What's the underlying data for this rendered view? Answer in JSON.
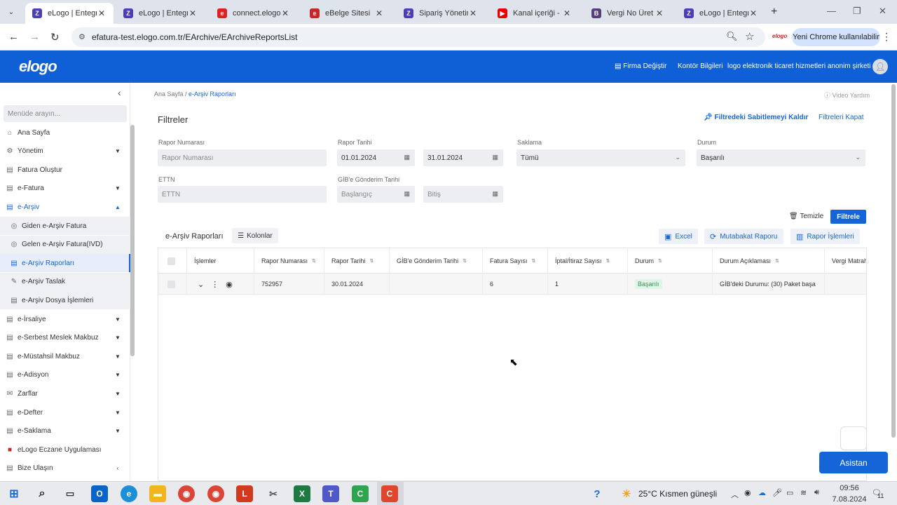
{
  "browser": {
    "tabs": [
      {
        "label": "eLogo | Entegrat",
        "active": true,
        "favicon_color": "#4b3fb3",
        "favicon_glyph": "Z"
      },
      {
        "label": "eLogo | Entegrat",
        "favicon_color": "#4b3fb3",
        "favicon_glyph": "Z"
      },
      {
        "label": "connect.elogo.cc",
        "favicon_color": "#d22",
        "favicon_glyph": "e"
      },
      {
        "label": "eBelge Sitesi",
        "favicon_color": "#c62828",
        "favicon_glyph": "e"
      },
      {
        "label": "Sipariş Yönetimi",
        "favicon_color": "#4b3fb3",
        "favicon_glyph": "Z"
      },
      {
        "label": "Kanal içeriği - Yo",
        "favicon_color": "#e00",
        "favicon_glyph": "▶"
      },
      {
        "label": "Vergi No Üret | V",
        "favicon_color": "#563d7c",
        "favicon_glyph": "B"
      },
      {
        "label": "eLogo | Entegrat",
        "favicon_color": "#4b3fb3",
        "favicon_glyph": "Z"
      }
    ],
    "url": "efatura-test.elogo.com.tr/EArchive/EArchiveReportsList",
    "ext_label": "elogo",
    "update_label": "Yeni Chrome kullanılabilir"
  },
  "header": {
    "logo": "elogo",
    "firma_degistir": "Firma Değiştir",
    "kontor": "Kontör Bilgileri",
    "company": "logo elektronik ticaret hizmetleri anonim şirketi"
  },
  "sidebar": {
    "search_placeholder": "Menüde arayın...",
    "items": [
      {
        "label": "Ana Sayfa",
        "icon": "⌂",
        "chev": ""
      },
      {
        "label": "Yönetim",
        "icon": "⚙",
        "chev": "▼"
      },
      {
        "label": "Fatura Oluştur",
        "icon": "▤",
        "chev": ""
      },
      {
        "label": "e-Fatura",
        "icon": "▤",
        "chev": "▼"
      },
      {
        "label": "e-Arşiv",
        "icon": "▤",
        "chev": "▲"
      },
      {
        "label": "Giden e-Arşiv Fatura",
        "icon": "◎",
        "chev": ""
      },
      {
        "label": "Gelen e-Arşiv Fatura(IVD)",
        "icon": "◎",
        "chev": ""
      },
      {
        "label": "e-Arşiv Raporları",
        "icon": "▤",
        "chev": ""
      },
      {
        "label": "e-Arşiv Taslak",
        "icon": "✎",
        "chev": ""
      },
      {
        "label": "e-Arşiv Dosya İşlemleri",
        "icon": "▤",
        "chev": ""
      },
      {
        "label": "e-İrsaliye",
        "icon": "▤",
        "chev": "▼"
      },
      {
        "label": "e-Serbest Meslek Makbuz",
        "icon": "▤",
        "chev": "▼"
      },
      {
        "label": "e-Müstahsil Makbuz",
        "icon": "▤",
        "chev": "▼"
      },
      {
        "label": "e-Adisyon",
        "icon": "▤",
        "chev": "▼"
      },
      {
        "label": "Zarflar",
        "icon": "✉",
        "chev": "▼"
      },
      {
        "label": "e-Defter",
        "icon": "▤",
        "chev": "▼"
      },
      {
        "label": "e-Saklama",
        "icon": "▤",
        "chev": "▼"
      },
      {
        "label": "eLogo Eczane Uygulaması",
        "icon": "■",
        "chev": ""
      },
      {
        "label": "Bize Ulaşın",
        "icon": "▤",
        "chev": "‹"
      }
    ]
  },
  "breadcrumb": {
    "home": "Ana Sayfa",
    "sep": " / ",
    "current": "e-Arşiv Raporları"
  },
  "video_help": "Video Yardım",
  "filters": {
    "title": "Filtreler",
    "unpin": "Filtredeki Sabitlemeyi Kaldır",
    "close": "Filtreleri Kapat",
    "rapor_no_label": "Rapor Numarası",
    "rapor_no_placeholder": "Rapor Numarası",
    "rapor_tarihi_label": "Rapor Tarihi",
    "rapor_tarihi_start": "01.01.2024",
    "rapor_tarihi_end": "31.01.2024",
    "saklama_label": "Saklama",
    "saklama_value": "Tümü",
    "durum_label": "Durum",
    "durum_value": "Başarılı",
    "ettn_label": "ETTN",
    "ettn_placeholder": "ETTN",
    "gib_label": "GİB'e Gönderim Tarihi",
    "gib_start_placeholder": "Başlangıç",
    "gib_end_placeholder": "Bitiş",
    "clear": "Temizle",
    "apply": "Filtrele"
  },
  "table": {
    "title": "e-Arşiv Raporları",
    "columns_btn": "Kolonlar",
    "excel": "Excel",
    "mutabakat": "Mutabakat Raporu",
    "rapor_islemleri": "Rapor İşlemleri",
    "headers": [
      "İşlemler",
      "Rapor Numarası",
      "Rapor Tarihi",
      "GİB'e Gönderim Tarihi",
      "Fatura Sayısı",
      "İptal/İtiraz Sayısı",
      "Durum",
      "Durum Açıklaması",
      "Vergi Matrahı"
    ],
    "rows": [
      {
        "rapor_no": "752957",
        "rapor_tarihi": "30.01.2024",
        "gib_tarihi": "",
        "fatura_sayisi": "6",
        "iptal_sayisi": "1",
        "durum": "Başarılı",
        "durum_aciklama": "GİB'deki Durumu: (30) Paket başa",
        "vergi_matrahi": ""
      }
    ]
  },
  "assistant_label": "Asistan",
  "taskbar": {
    "weather": "25°C  Kısmen güneşli",
    "time": "09:56",
    "date": "7.08.2024",
    "notif_count": "11"
  }
}
